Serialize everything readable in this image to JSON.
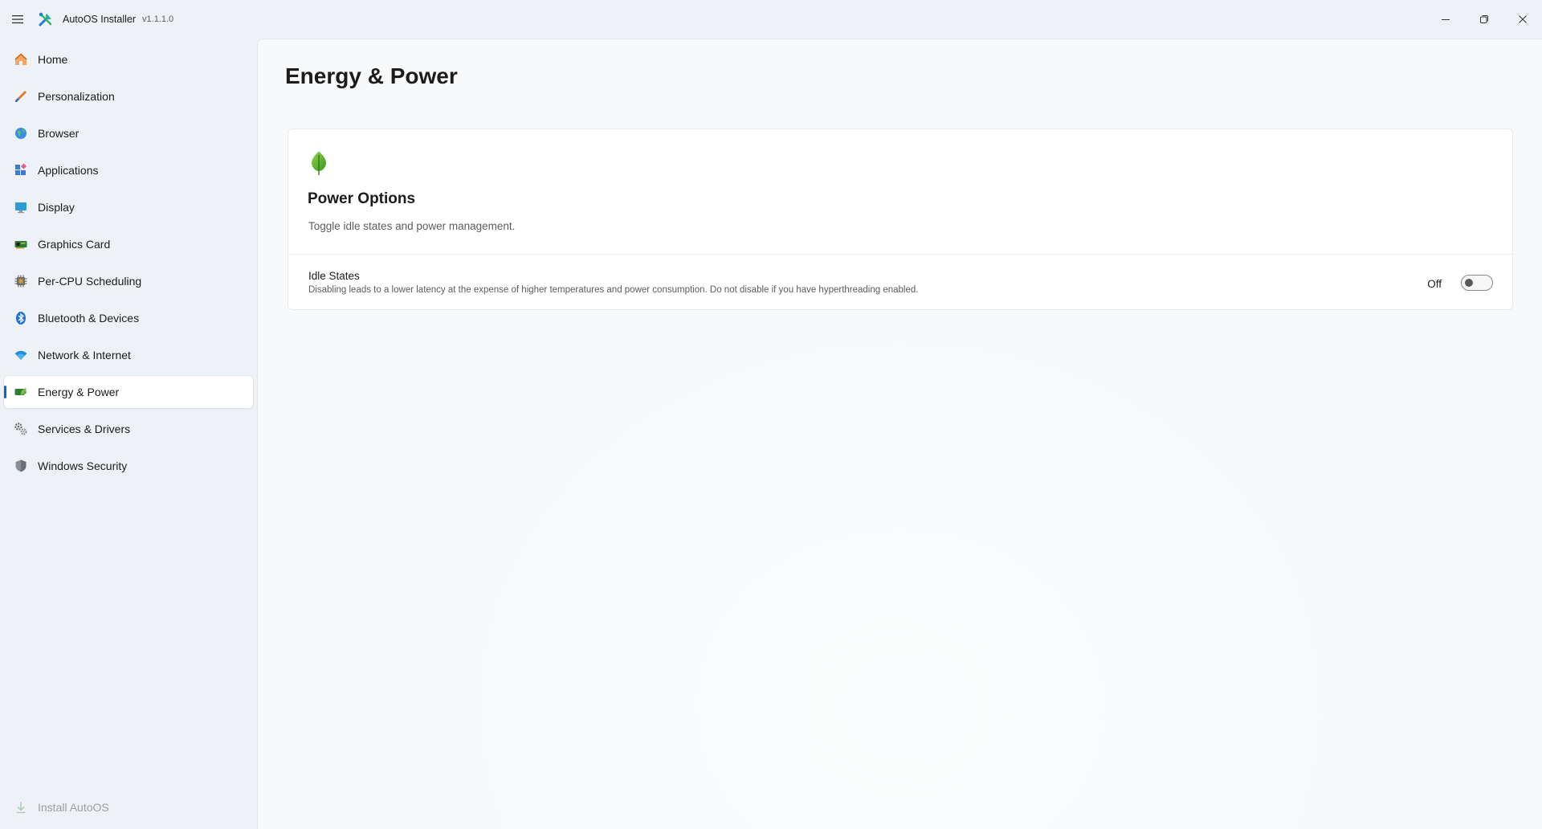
{
  "window": {
    "title": "AutoOS Installer",
    "version": "v1.1.1.0",
    "icons": {
      "menu": "hamburger-menu-icon",
      "logo": "tools-icon",
      "minimize": "minimize-icon",
      "restore": "restore-icon",
      "close": "close-icon"
    }
  },
  "sidebar": {
    "items": [
      {
        "label": "Home",
        "icon": "home-icon"
      },
      {
        "label": "Personalization",
        "icon": "brush-icon"
      },
      {
        "label": "Browser",
        "icon": "globe-icon"
      },
      {
        "label": "Applications",
        "icon": "apps-icon"
      },
      {
        "label": "Display",
        "icon": "monitor-icon"
      },
      {
        "label": "Graphics Card",
        "icon": "gpu-icon"
      },
      {
        "label": "Per-CPU Scheduling",
        "icon": "cpu-icon"
      },
      {
        "label": "Bluetooth & Devices",
        "icon": "bluetooth-icon"
      },
      {
        "label": "Network & Internet",
        "icon": "wifi-icon"
      },
      {
        "label": "Energy & Power",
        "icon": "battery-leaf-icon",
        "active": true
      },
      {
        "label": "Services & Drivers",
        "icon": "gears-icon"
      },
      {
        "label": "Windows Security",
        "icon": "shield-icon"
      }
    ],
    "footer": {
      "label": "Install AutoOS",
      "icon": "download-icon",
      "disabled": true
    }
  },
  "main": {
    "page_title": "Energy & Power",
    "card": {
      "icon": "leaf-icon",
      "title": "Power Options",
      "description": "Toggle idle states and power management.",
      "setting": {
        "title": "Idle States",
        "description": "Disabling leads to a lower latency at the expense of higher temperatures and power consumption. Do not disable if you have hyperthreading enabled.",
        "state_label": "Off",
        "enabled": false
      }
    }
  },
  "colors": {
    "accent": "#0a64c8",
    "leaf_green": "#4cbb17",
    "sidebar_bg": "#eef1f5",
    "content_bg": "#f7f9fb"
  }
}
